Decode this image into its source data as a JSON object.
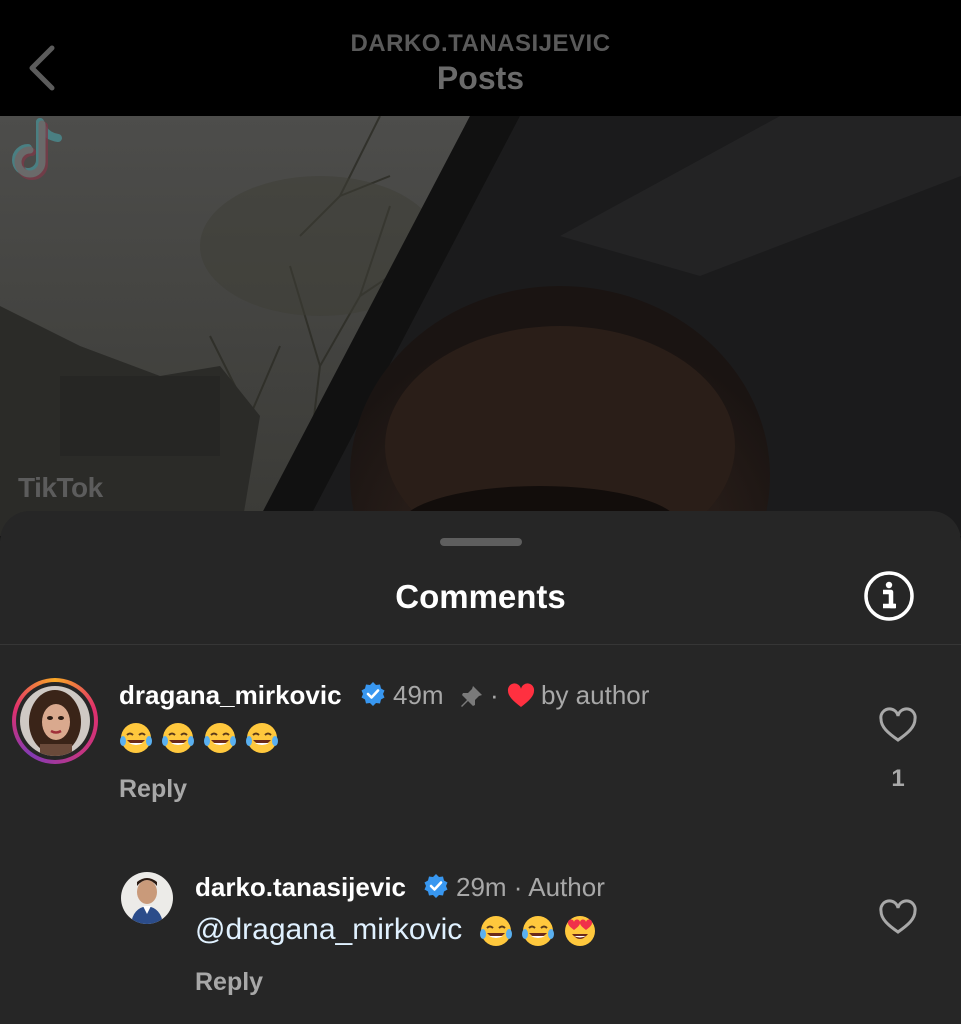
{
  "header": {
    "username": "DARKO.TANASIJEVIC",
    "title": "Posts"
  },
  "video": {
    "watermark": "TikTok"
  },
  "comments_sheet": {
    "title": "Comments",
    "comments": [
      {
        "username": "dragana_mirkovic",
        "time": "49m",
        "separator": "·",
        "liked_by_author": "by author",
        "text_emojis": [
          "face-with-tears-of-joy",
          "face-with-tears-of-joy",
          "face-with-tears-of-joy",
          "face-with-tears-of-joy"
        ],
        "reply_label": "Reply",
        "like_count": "1"
      },
      {
        "username": "darko.tanasijevic",
        "time": "29m · Author",
        "mention": "@dragana_mirkovic",
        "text_emojis": [
          "face-with-tears-of-joy",
          "face-with-tears-of-joy",
          "smiling-face-with-heart-eyes"
        ],
        "reply_label": "Reply"
      }
    ]
  },
  "colors": {
    "background": "#000000",
    "sheet": "#262626",
    "verified": "#3897f0",
    "heart_red": "#ff3040",
    "secondary_text": "#a8a8a8"
  }
}
